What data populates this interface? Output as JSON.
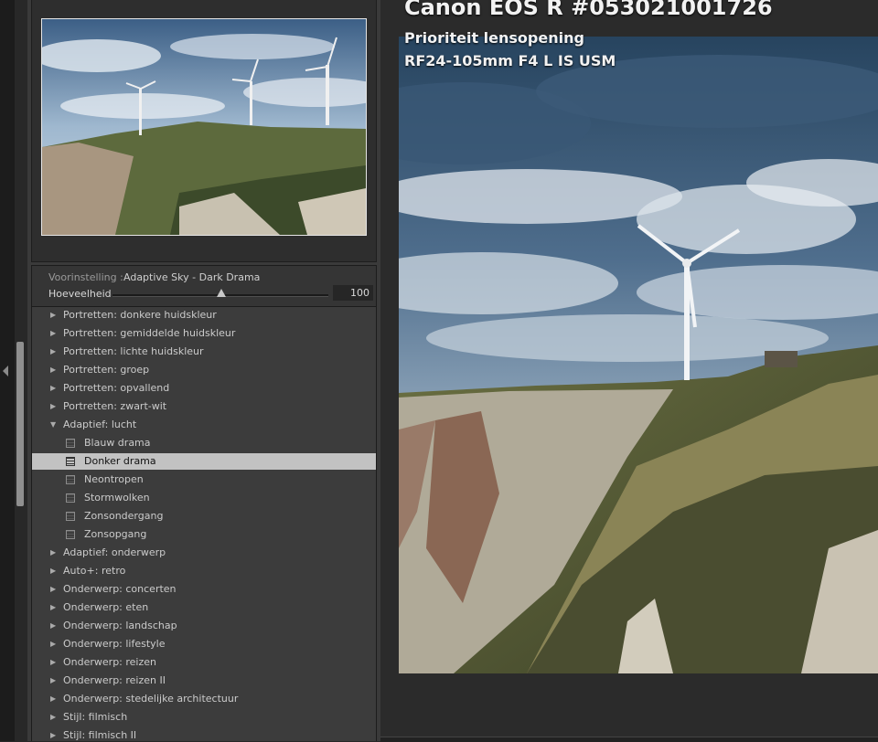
{
  "navigator": {
    "image": "Windmill on cliffs thumbnail"
  },
  "preset": {
    "label": "Voorinstelling :",
    "value": "Adaptive Sky - Dark Drama",
    "amount_label": "Hoeveelheid",
    "amount_value": "100"
  },
  "groups": [
    {
      "label": "Portretten: donkere huidskleur",
      "expanded": false
    },
    {
      "label": "Portretten: gemiddelde huidskleur",
      "expanded": false
    },
    {
      "label": "Portretten: lichte huidskleur",
      "expanded": false
    },
    {
      "label": "Portretten: groep",
      "expanded": false
    },
    {
      "label": "Portretten: opvallend",
      "expanded": false
    },
    {
      "label": "Portretten: zwart-wit",
      "expanded": false
    },
    {
      "label": "Adaptief: lucht",
      "expanded": true
    },
    {
      "label": "Blauw drama",
      "child": true
    },
    {
      "label": "Donker drama",
      "child": true,
      "selected": true
    },
    {
      "label": "Neontropen",
      "child": true
    },
    {
      "label": "Stormwolken",
      "child": true
    },
    {
      "label": "Zonsondergang",
      "child": true
    },
    {
      "label": "Zonsopgang",
      "child": true
    },
    {
      "label": "Adaptief: onderwerp",
      "expanded": false
    },
    {
      "label": "Auto+: retro",
      "expanded": false
    },
    {
      "label": "Onderwerp: concerten",
      "expanded": false
    },
    {
      "label": "Onderwerp: eten",
      "expanded": false
    },
    {
      "label": "Onderwerp: landschap",
      "expanded": false
    },
    {
      "label": "Onderwerp: lifestyle",
      "expanded": false
    },
    {
      "label": "Onderwerp: reizen",
      "expanded": false
    },
    {
      "label": "Onderwerp: reizen II",
      "expanded": false
    },
    {
      "label": "Onderwerp: stedelijke architectuur",
      "expanded": false
    },
    {
      "label": "Stijl: filmisch",
      "expanded": false
    },
    {
      "label": "Stijl: filmisch II",
      "expanded": false
    }
  ],
  "info": {
    "camera": "Canon EOS R #053021001726",
    "mode": "Prioriteit lensopening",
    "lens": "RF24-105mm F4 L IS USM"
  },
  "colors": {
    "selected_row": "#c2c2c2",
    "panel_bg": "#3a3a3a"
  }
}
